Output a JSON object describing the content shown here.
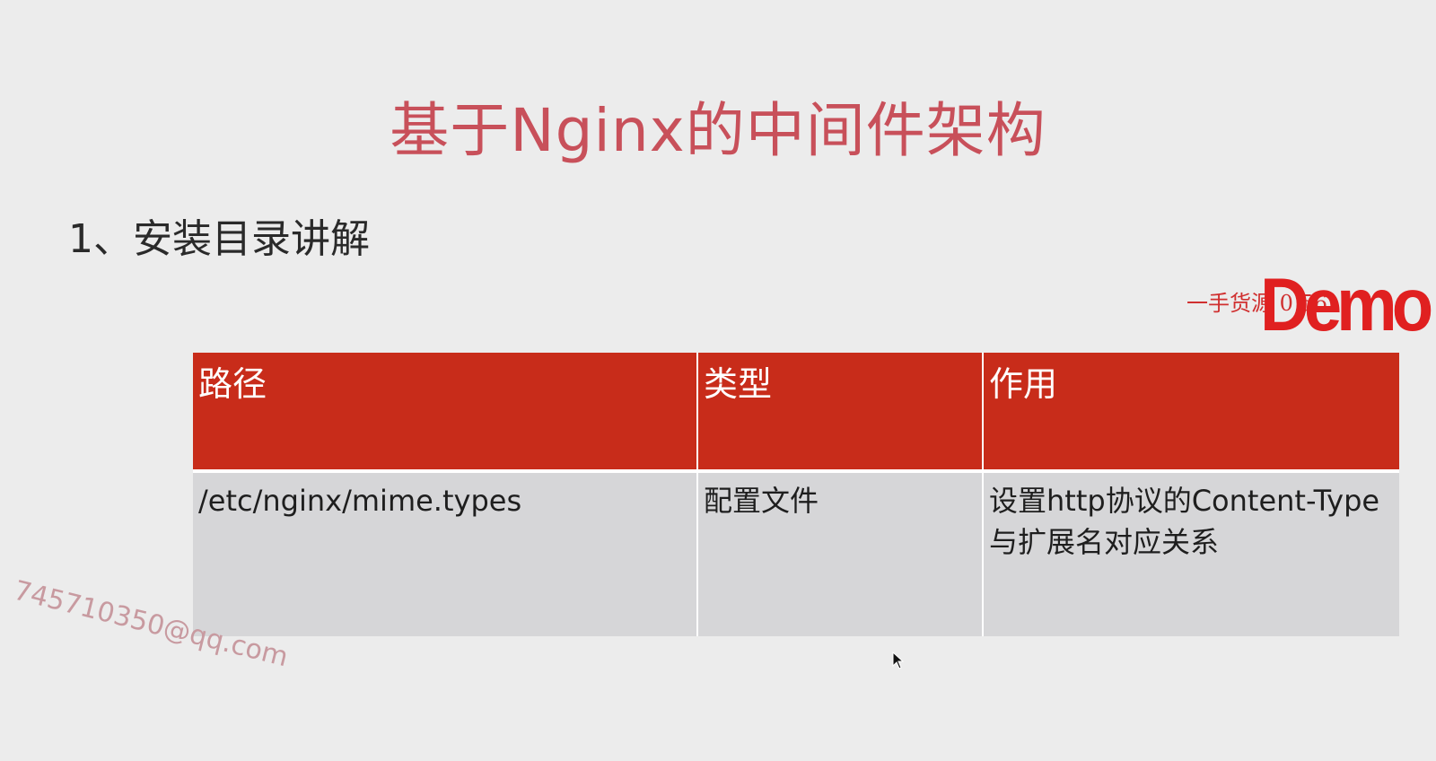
{
  "slide": {
    "title": "基于Nginx的中间件架构",
    "subtitle": "1、安装目录讲解"
  },
  "watermarks": {
    "demo_small": "一手货源 0 56",
    "demo_big": "Demo",
    "email": "745710350@qq.com"
  },
  "table": {
    "headers": [
      "路径",
      "类型",
      "作用"
    ],
    "rows": [
      [
        "/etc/nginx/mime.types",
        "配置文件",
        "设置http协议的Content-Type与扩展名对应关系"
      ]
    ]
  },
  "colors": {
    "title": "#c8505a",
    "header_bg": "#c82c1a",
    "row_bg": "#d6d6d8",
    "watermark": "#e02020"
  }
}
